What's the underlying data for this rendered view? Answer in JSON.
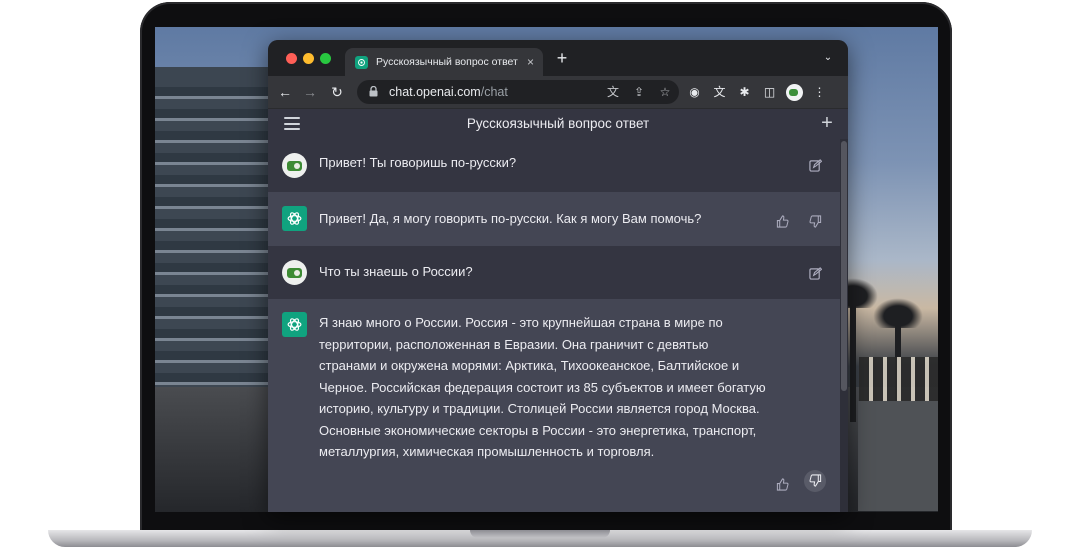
{
  "browser": {
    "tab_title": "Русскоязычный вопрос ответ",
    "tab_close": "×",
    "new_tab": "+",
    "tab_menu": "⌄",
    "url_host": "chat.openai.com",
    "url_path": "/chat"
  },
  "app": {
    "title": "Русскоязычный вопрос ответ",
    "new_chat": "+"
  },
  "messages": [
    {
      "role": "user",
      "text": "Привет! Ты говоришь по-русски?"
    },
    {
      "role": "assistant",
      "text": "Привет! Да, я могу говорить по-русски. Как я могу Вам помочь?"
    },
    {
      "role": "user",
      "text": "Что ты знаешь о России?"
    },
    {
      "role": "assistant",
      "text": "Я знаю много о России. Россия - это крупнейшая страна в мире по территории, расположенная в Евразии. Она граничит с девятью странами и окружена морями: Арктика, Тихоокеанское, Балтийское и Черное. Российская федерация состоит из 85 субъектов и имеет богатую историю, культуру и традиции. Столицей России является город Москва. Основные экономические секторы в России - это энергетика, транспорт, металлургия, химическая промышленность и торговля."
    }
  ],
  "colors": {
    "accent": "#10a37f",
    "user_bg": "#343541",
    "assistant_bg": "#444654"
  }
}
